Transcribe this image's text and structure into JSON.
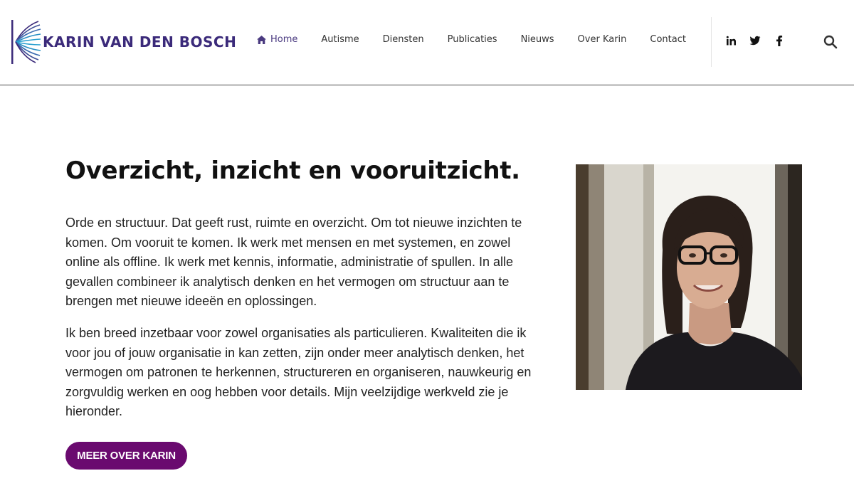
{
  "brand": {
    "name": "KARIN VAN DEN BOSCH",
    "color": "#3b2a7a",
    "accent": "#2a8fc4"
  },
  "nav": {
    "items": [
      {
        "label": "Home",
        "active": true
      },
      {
        "label": "Autisme"
      },
      {
        "label": "Diensten"
      },
      {
        "label": "Publicaties"
      },
      {
        "label": "Nieuws"
      },
      {
        "label": "Over Karin"
      },
      {
        "label": "Contact"
      }
    ]
  },
  "social": {
    "icons": [
      "linkedin-icon",
      "twitter-icon",
      "facebook-icon"
    ]
  },
  "search": {
    "icon": "search-icon"
  },
  "main": {
    "headline": "Overzicht, inzicht en vooruitzicht.",
    "paragraph_1": "Orde en structuur. Dat geeft rust, ruimte en overzicht. Om tot nieuwe inzichten te komen. Om vooruit te komen. Ik werk met mensen en met systemen, en zowel online als offline. Ik werk met kennis, informatie, administratie of spullen. In alle gevallen combineer ik analytisch denken en het vermogen om structuur aan te brengen met nieuwe ideeën en oplossingen.",
    "paragraph_2": "Ik ben breed inzetbaar voor zowel organisaties als particulieren. Kwaliteiten die ik voor jou of jouw organisatie in kan zetten, zijn onder meer analytisch denken, het vermogen om patronen te herkennen, structureren en organiseren, nauwkeurig en zorgvuldig werken en oog hebben voor details. Mijn veelzijdige werkveld zie je hieronder.",
    "cta_label": "MEER OVER KARIN",
    "cta_color": "#6a0a6f"
  }
}
